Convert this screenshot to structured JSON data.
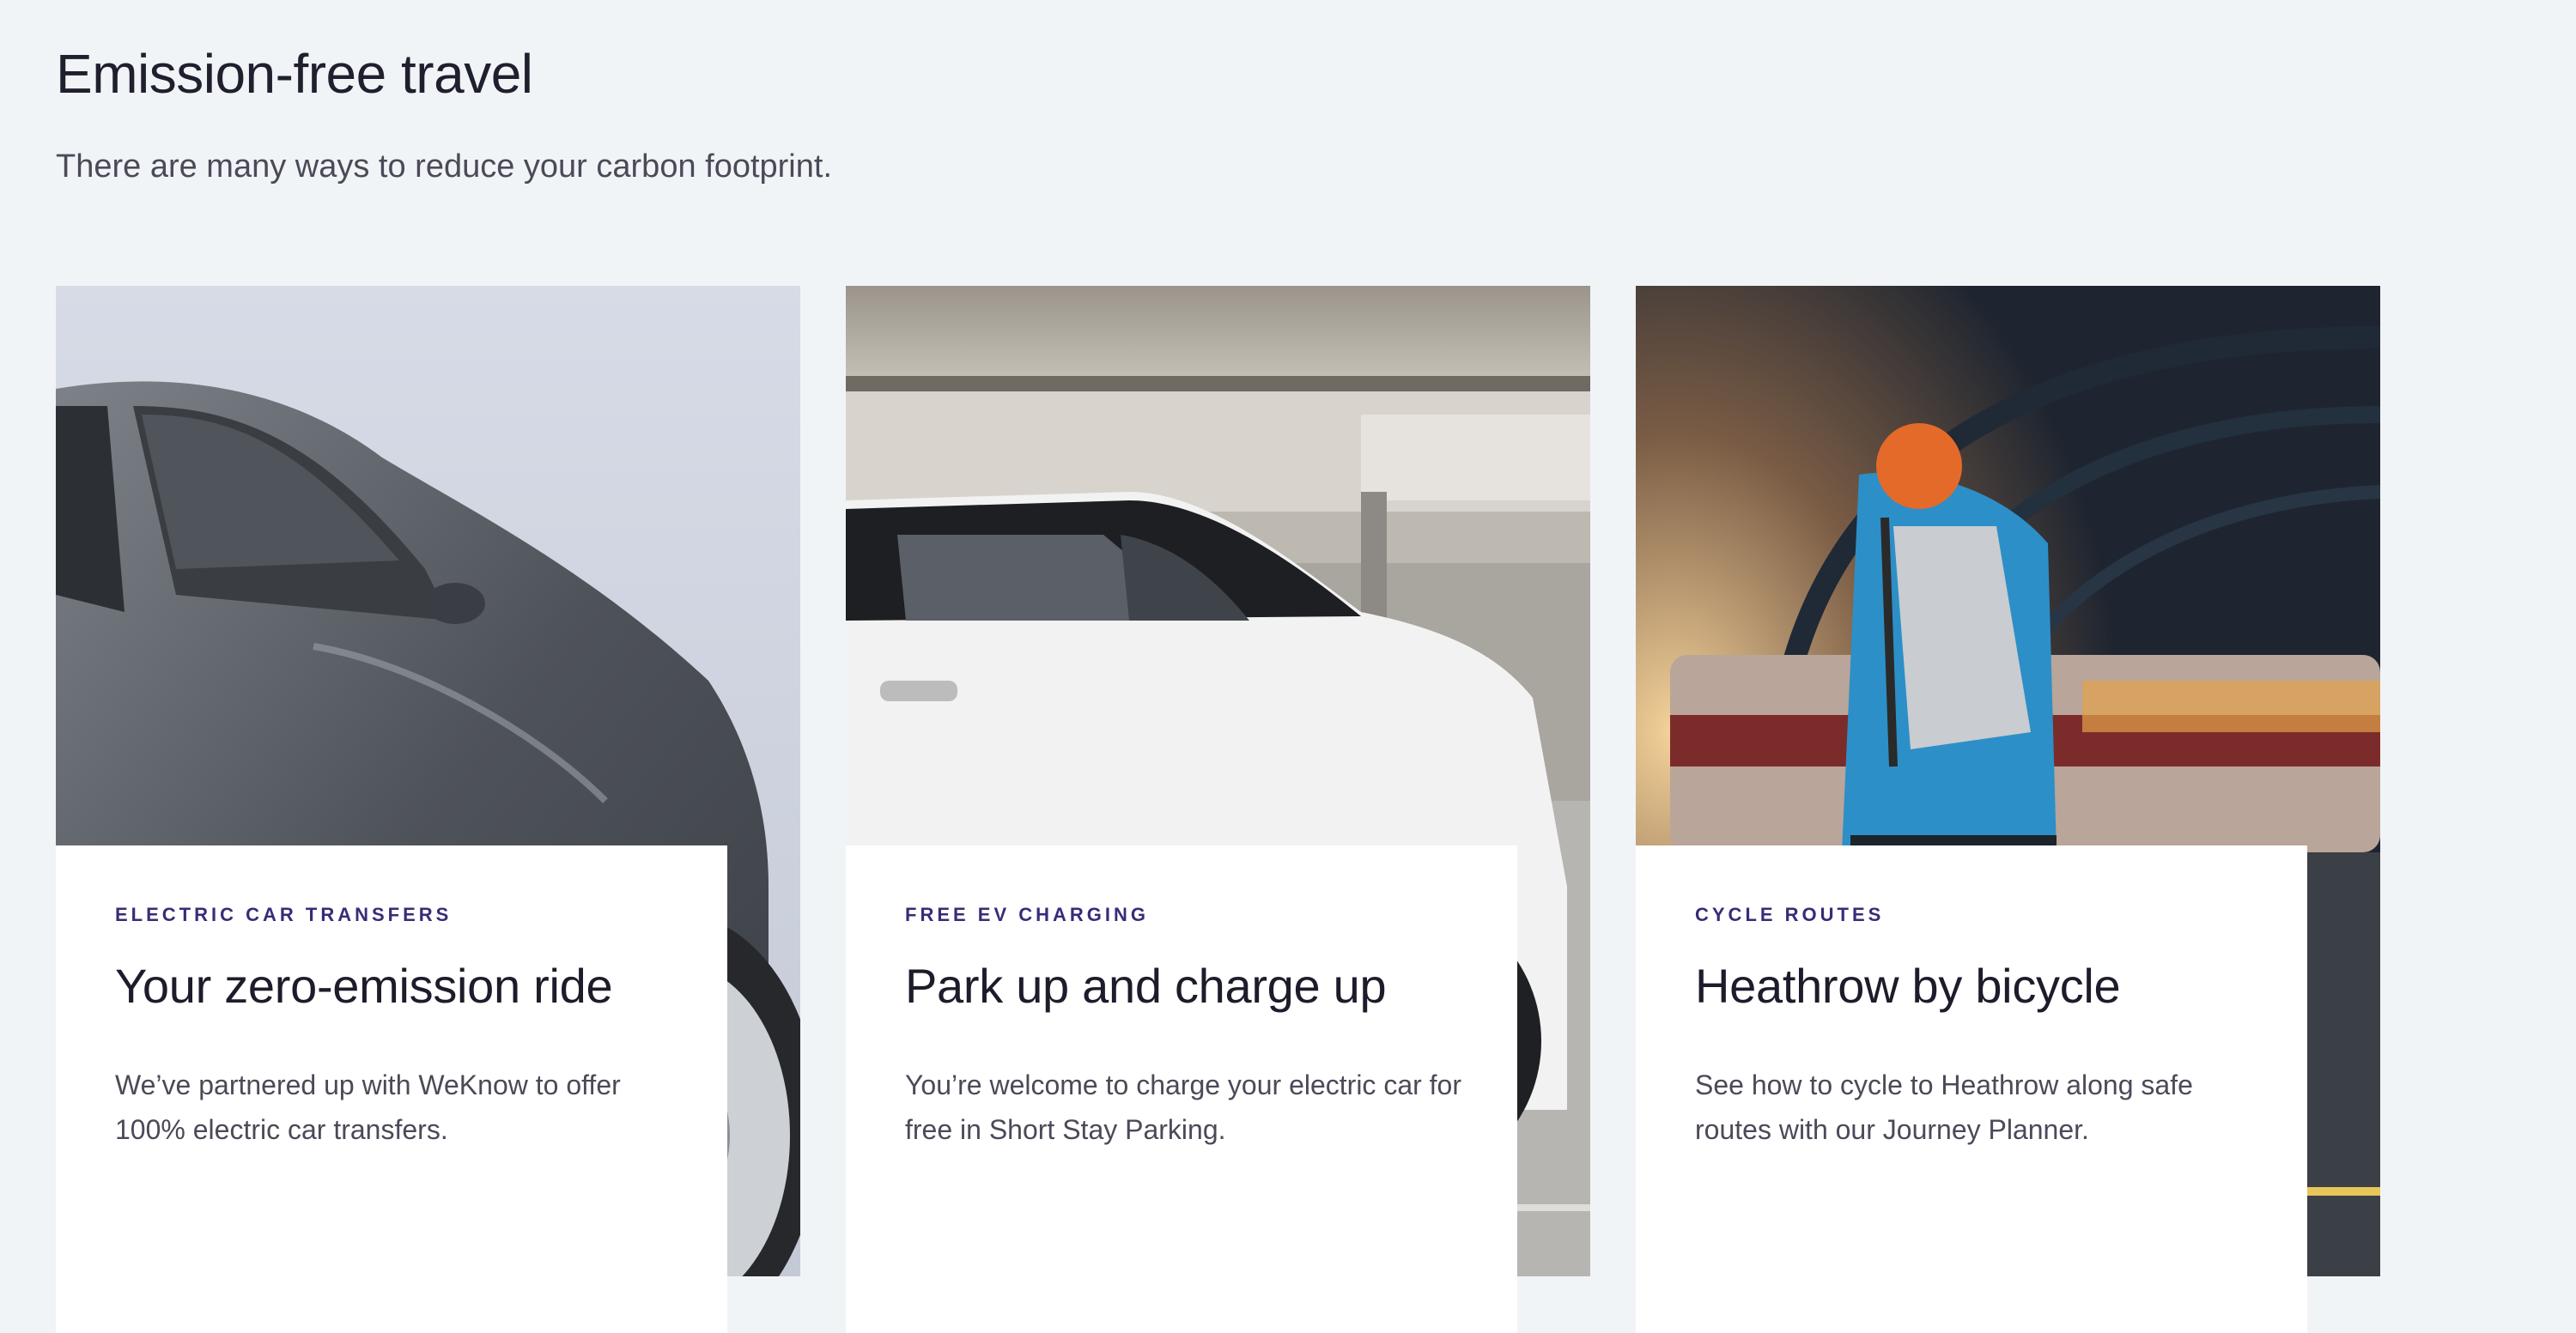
{
  "section": {
    "title": "Emission-free travel",
    "subtitle": "There are many ways to reduce your carbon footprint."
  },
  "cards": [
    {
      "kicker": "ELECTRIC CAR TRANSFERS",
      "title": "Your zero-emission ride",
      "text": "We’ve partnered up with WeKnow to offer 100% electric car transfers.",
      "image": "grey-electric-car-photo"
    },
    {
      "kicker": "FREE EV CHARGING",
      "title": "Park up and charge up",
      "text": "You’re welcome to charge your electric car for free in Short Stay Parking.",
      "image": "white-ev-in-car-park-photo"
    },
    {
      "kicker": "CYCLE ROUTES",
      "title": "Heathrow by bicycle",
      "text": "See how to cycle to Heathrow along safe routes with our Journey Planner.",
      "image": "cyclist-at-station-photo"
    }
  ],
  "colors": {
    "page_background": "#f1f4f7",
    "kicker": "#3b2a78",
    "heading": "#1f1f2e",
    "body_text": "#4a4a58",
    "panel": "#ffffff"
  }
}
